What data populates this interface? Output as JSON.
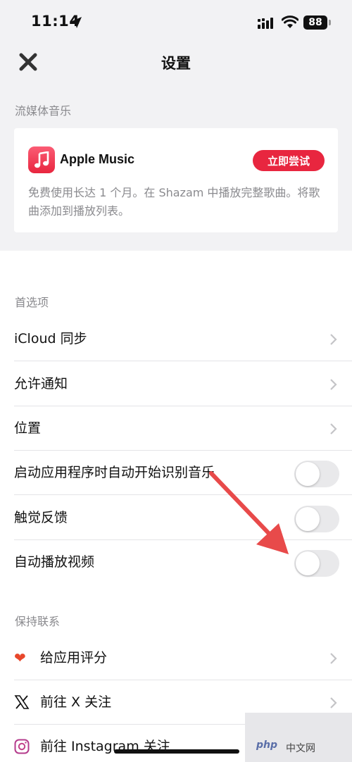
{
  "status_bar": {
    "time": "11:14",
    "battery": "88"
  },
  "nav": {
    "title": "设置"
  },
  "streaming": {
    "header": "流媒体音乐",
    "card": {
      "title": "Apple Music",
      "button": "立即尝试",
      "description": "免费使用长达 1 个月。在 Shazam 中播放完整歌曲。将歌曲添加到播放列表。"
    }
  },
  "preferences": {
    "header": "首选项",
    "rows": [
      {
        "label": "iCloud 同步",
        "type": "chevron"
      },
      {
        "label": "允许通知",
        "type": "chevron"
      },
      {
        "label": "位置",
        "type": "chevron"
      },
      {
        "label": "启动应用程序时自动开始识别音乐",
        "type": "toggle",
        "on": false
      },
      {
        "label": "触觉反馈",
        "type": "toggle",
        "on": false
      },
      {
        "label": "自动播放视频",
        "type": "toggle",
        "on": false
      }
    ]
  },
  "contact": {
    "header": "保持联系",
    "rows": [
      {
        "label": "给应用评分",
        "icon": "heart-icon"
      },
      {
        "label": "前往 X 关注",
        "icon": "x-logo-icon"
      },
      {
        "label": "前往 Instagram 关注",
        "icon": "instagram-icon"
      }
    ]
  },
  "watermark": {
    "prefix": "php",
    "text": "中文网"
  },
  "colors": {
    "accent": "#e8263f",
    "annotation_arrow": "#e84a4a",
    "toggle_off": "#e9e9eb"
  }
}
